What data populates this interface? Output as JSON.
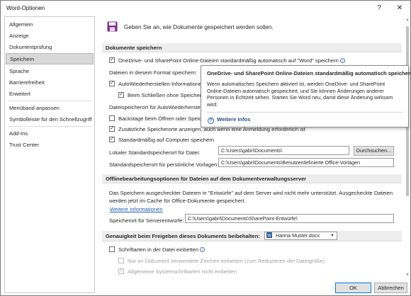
{
  "window": {
    "title": "Word-Optionen",
    "help_glyph": "?",
    "close_glyph": "✕"
  },
  "sidebar": {
    "items": [
      {
        "label": "Allgemein"
      },
      {
        "label": "Anzeige"
      },
      {
        "label": "Dokumentprüfung"
      },
      {
        "label": "Speichern",
        "selected": true
      },
      {
        "label": "Sprache"
      },
      {
        "label": "Barrierefreiheit"
      },
      {
        "label": "Erweitert"
      },
      {
        "label": "Menüband anpassen"
      },
      {
        "label": "Symbolleiste für den Schnellzugriff"
      },
      {
        "label": "Add-Ins"
      },
      {
        "label": "Trust Center"
      }
    ]
  },
  "header": {
    "text": "Geben Sie an, wie Dokumente gespeichert werden sollen."
  },
  "save_section": {
    "title": "Dokumente speichern",
    "autosave_label": "OneDrive- und SharePoint Online-Dateien standardmäßig automatisch auf \"Word\" speichern",
    "format_label": "Dateien in diesem Format speichern:",
    "autorecover_label": "AutoWiederherstellen-Informationen speichern",
    "keep_last_label": "Beim Schließen ohne Speichern",
    "autorecover_location_label": "Dateispeicherort für AutoWiederherstellen",
    "backstage_label": "Backstage beim Öffnen oder Speich",
    "additional_locations_label": "Zusätzliche Speicherorte anzeigen, auch wenn eine Anmeldung erforderlich ist",
    "default_computer_label": "Standardmäßig auf Computer speichern",
    "local_default_label": "Lokaler Standardspeicherort für Datei:",
    "local_default_value": "C:\\Users\\gabri\\Documents\\",
    "browse_label": "Durchsuchen...",
    "templates_label": "Standardspeicherort für persönliche Vorlagen:",
    "templates_value": "C:\\Users\\gabri\\Documents\\Benutzerdefinierte Office-Vorlagen"
  },
  "offline_section": {
    "title": "Offlinebearbeitungsoptionen für Dateien auf dem Dokumentverwaltungsserver",
    "description_line1": "Das Speichern ausgecheckter Dateien in \"Entwürfe\" auf dem Server wird nicht mehr unterstützt. Ausgecheckte Dateien",
    "description_line2": "werden jetzt im Cache für Office-Dokumente gespeichert.",
    "more_info_link": "Weitere Informationen",
    "drafts_label": "Speicherort für Serverentwürfe:",
    "drafts_value": "C:\\Users\\gabri\\Documents\\SharePoint-Entwürfe\\"
  },
  "fidelity_section": {
    "title": "Genauigkeit beim Freigeben dieses Dokuments beibehalten:",
    "document_name": "Hanna Muster.docx",
    "embed_fonts_label": "Schriftarten in der Datei einbetten",
    "embed_used_chars_label": "Nur im Dokument verwendete Zeichen einbetten (zum Reduzieren der Dateigröße)",
    "no_common_fonts_label": "Allgemeine Systemschriftarten nicht einbetten"
  },
  "tooltip": {
    "title": "OneDrive- und SharePoint Online-Dateien standardmäßig automatisch speichern",
    "body": "Wenn automatisches Speichern aktiviert ist, werden OneDrive- und SharePoint Online-Dateien automatisch gespeichert, und Sie können Änderungen anderer Personen in Echtzeit sehen. Starten Sie Word neu, damit diese Änderung wirksam wird.",
    "more_link": "Weitere Infos",
    "more_glyph": "?"
  },
  "footer": {
    "ok_label": "OK",
    "cancel_label": "Abbrechen"
  },
  "colors": {
    "accent": "#0078d4",
    "link": "#1f5fa8",
    "save_icon": "#7b2c8f",
    "selected_nav": "#d9d9d9"
  }
}
